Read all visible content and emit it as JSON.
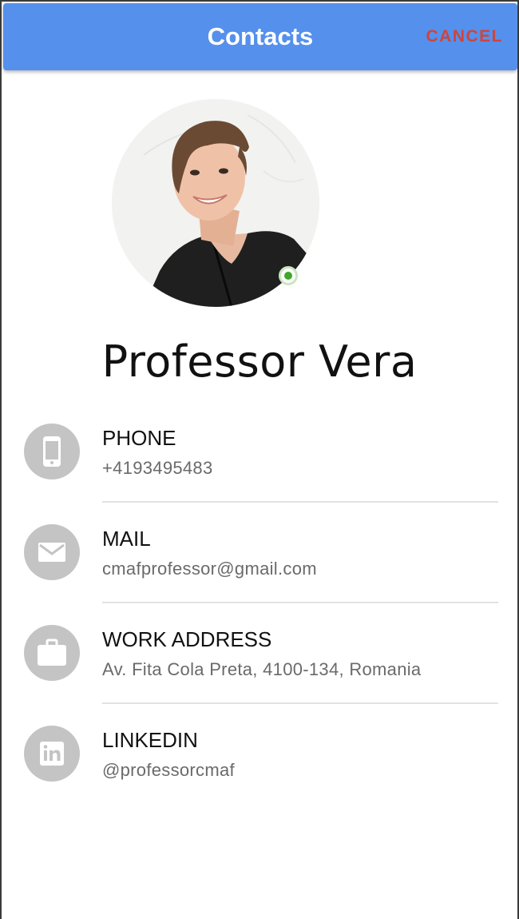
{
  "header": {
    "title": "Contacts",
    "cancel_label": "CANCEL",
    "background_color": "#5590ec",
    "cancel_color": "#d0443a"
  },
  "profile": {
    "name": "Professor Vera",
    "online": true,
    "status_color": "#3fa72c"
  },
  "contacts": [
    {
      "label": "PHONE",
      "value": "+4193495483",
      "icon": "phone-icon"
    },
    {
      "label": "MAIL",
      "value": "cmafprofessor@gmail.com",
      "icon": "mail-icon"
    },
    {
      "label": "WORK ADDRESS",
      "value": "Av. Fita Cola Preta, 4100-134, Romania",
      "icon": "briefcase-icon"
    },
    {
      "label": "LINKEDIN",
      "value": "@professorcmaf",
      "icon": "linkedin-icon"
    }
  ]
}
